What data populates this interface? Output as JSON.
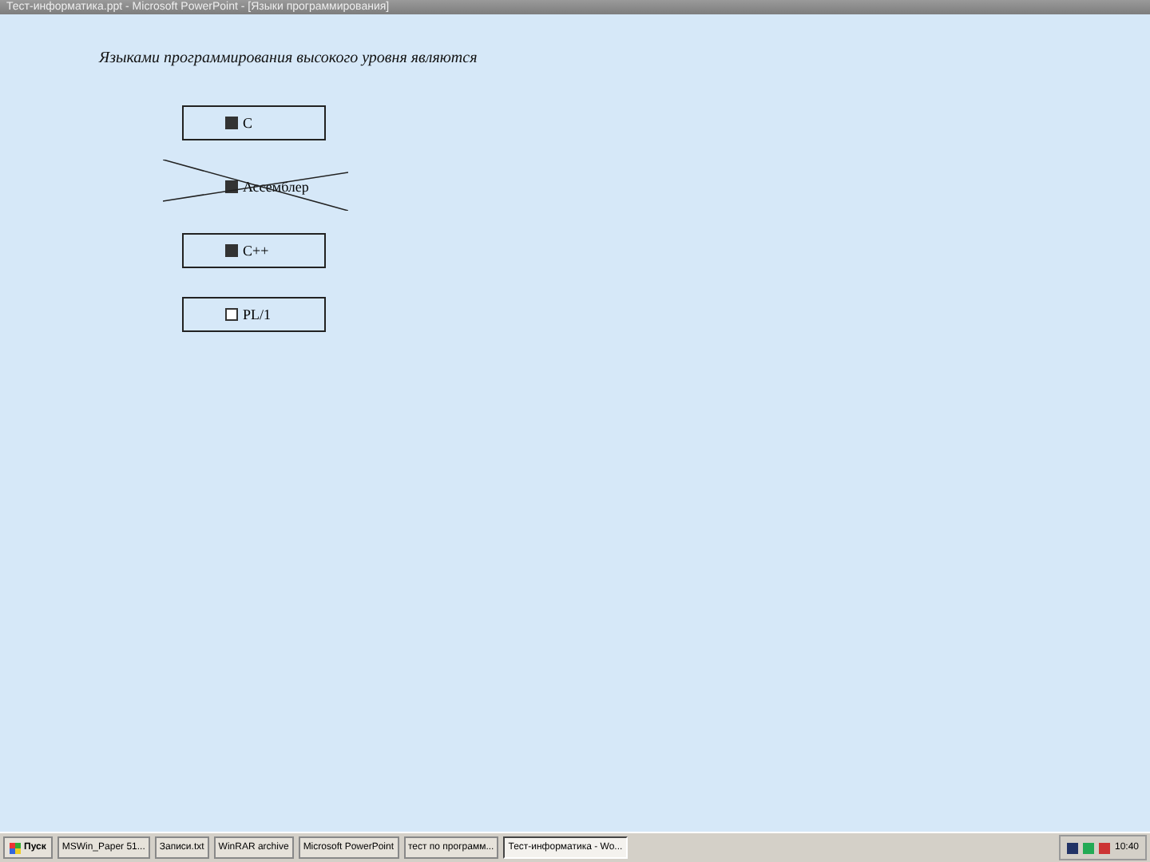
{
  "window": {
    "title": "Тест-информатика.ppt - Microsoft PowerPoint - [Языки программирования]"
  },
  "question": "Языками программирования высокого уровня являются",
  "options": [
    {
      "label": "C",
      "checked": true,
      "crossed": false
    },
    {
      "label": "Ассемблер",
      "checked": true,
      "crossed": true
    },
    {
      "label": "C++",
      "checked": true,
      "crossed": false
    },
    {
      "label": "PL/1",
      "checked": false,
      "crossed": false
    }
  ],
  "taskbar": {
    "start": "Пуск",
    "items": [
      {
        "label": "MSWin_Paper 51...",
        "selected": false
      },
      {
        "label": "Записи.txt",
        "selected": false
      },
      {
        "label": "WinRAR archive",
        "selected": false
      },
      {
        "label": "Microsoft PowerPoint",
        "selected": false
      },
      {
        "label": "тест по программ...",
        "selected": false
      },
      {
        "label": "Тест-информатика - Wo...",
        "selected": true
      }
    ],
    "clock": "10:40"
  }
}
